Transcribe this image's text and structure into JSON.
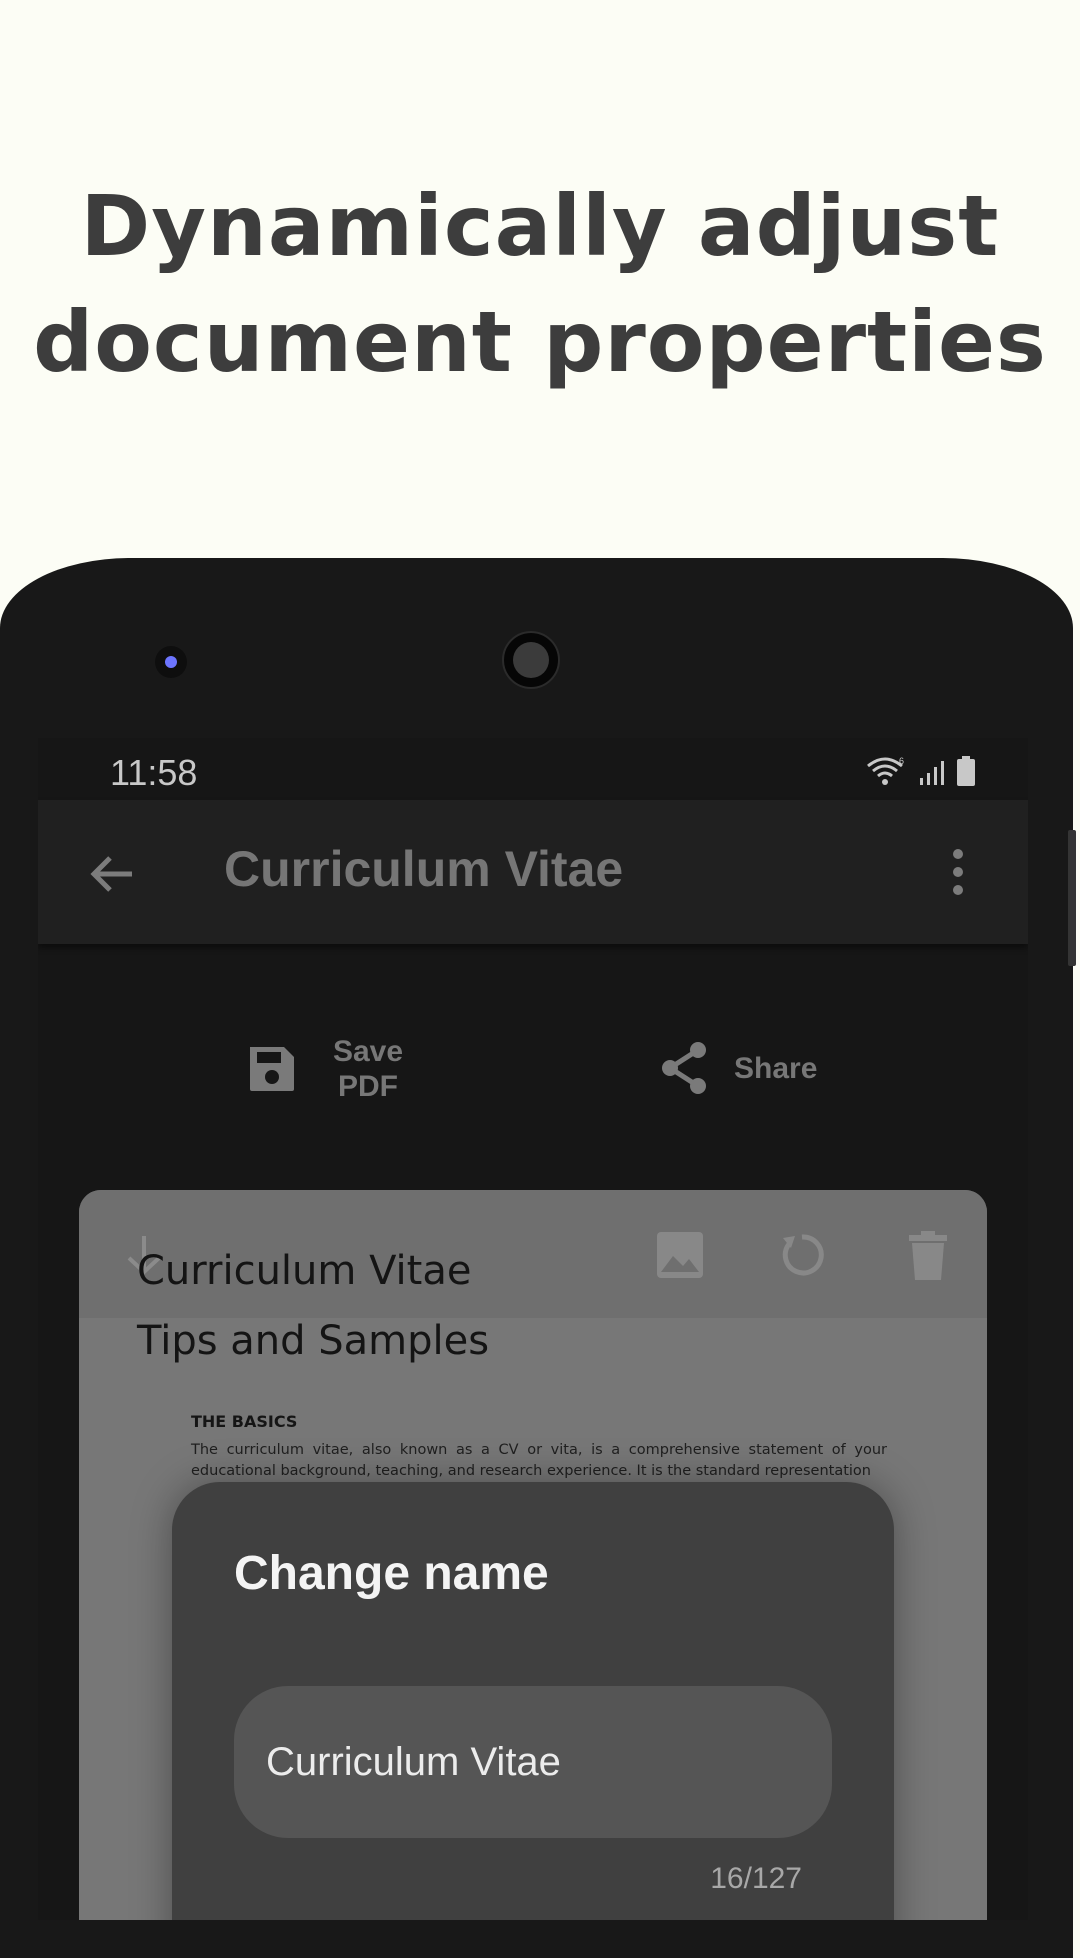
{
  "headline": {
    "line1": "Dynamically adjust",
    "line2": "document properties"
  },
  "status_bar": {
    "time": "11:58",
    "icons": [
      "wifi-icon",
      "signal-icon",
      "battery-icon"
    ]
  },
  "app_bar": {
    "title": "Curriculum Vitae",
    "back_icon": "arrow-left-icon",
    "menu_icon": "more-vertical-icon"
  },
  "actions": {
    "save_label": "Save PDF",
    "share_label": "Share"
  },
  "document": {
    "toolbar_icons": [
      "download-icon",
      "image-icon",
      "rotate-icon",
      "trash-icon"
    ],
    "title": "Curriculum Vitae",
    "subtitle": "Tips and Samples",
    "section_heading": "THE BASICS",
    "body_text": "The curriculum vitae, also known as a CV or vita, is a comprehensive statement of your educational background, teaching, and research experience. It is the standard representation"
  },
  "dialog": {
    "title": "Change name",
    "field_value": "Curriculum Vitae",
    "counter": "16/127"
  },
  "colors": {
    "page_background": "#fcfdf5",
    "headline": "#3d3d3d",
    "phone_body": "#181818",
    "dialog_background": "#404040"
  }
}
